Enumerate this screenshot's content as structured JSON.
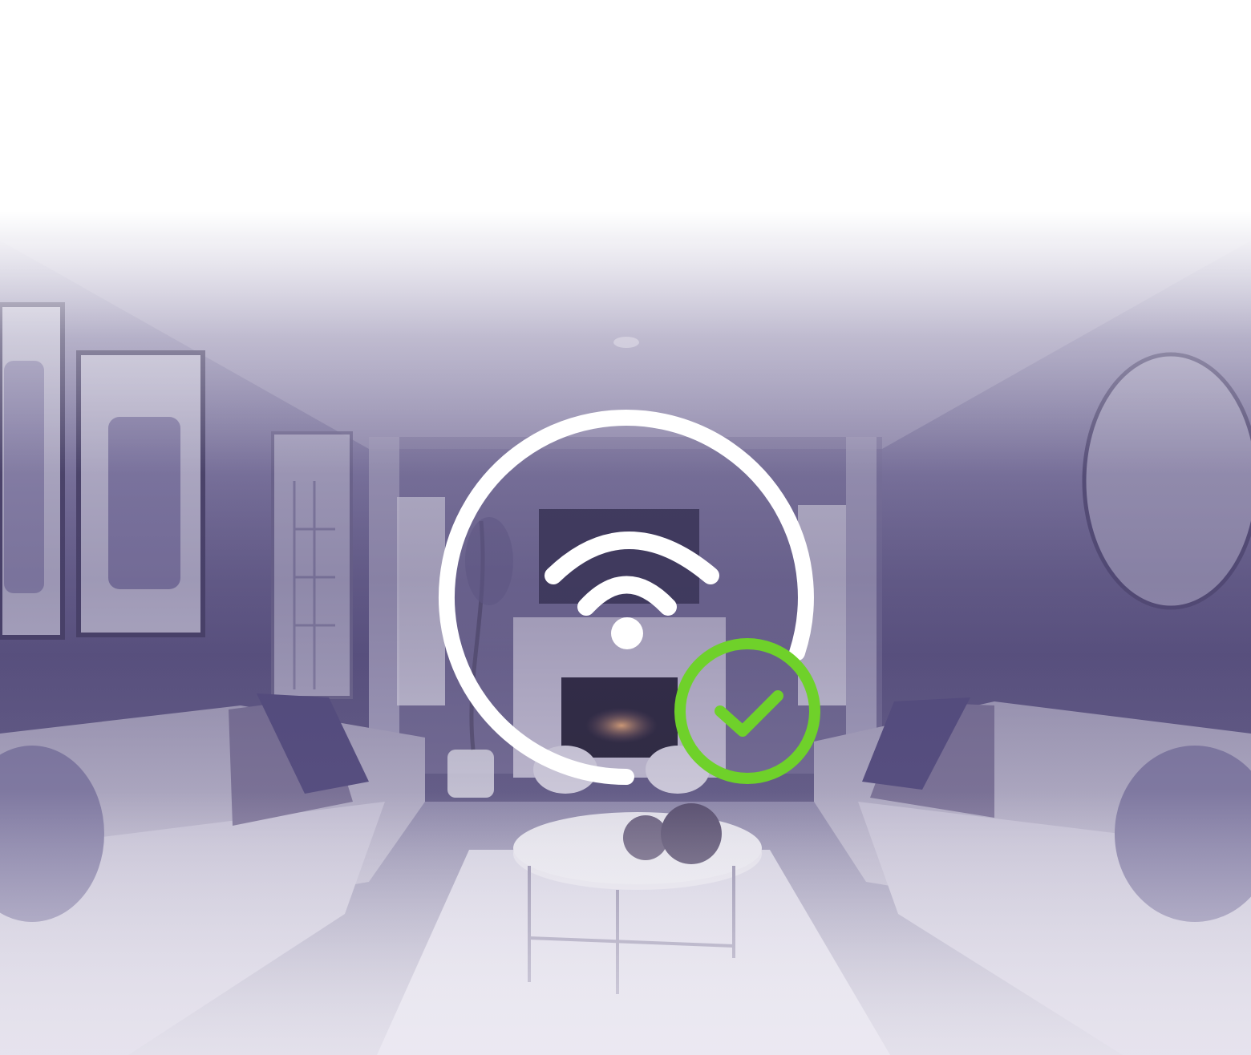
{
  "scene": {
    "description_icon": "living-room-photo",
    "colors": {
      "top_fade": "#ffffff",
      "tint_top": "#c9c5dc",
      "tint_mid": "#6f6891",
      "tint_deep": "#4a4270",
      "tint_bottom": "#dcdae6"
    }
  },
  "status_graphic": {
    "wifi_icon": "wifi-icon",
    "ring_icon": "progress-ring-icon",
    "check_icon": "check-circle-icon",
    "progress": 0.8,
    "colors": {
      "wifi": "#ffffff",
      "ring": "#ffffff",
      "check": "#6fd12a"
    }
  }
}
